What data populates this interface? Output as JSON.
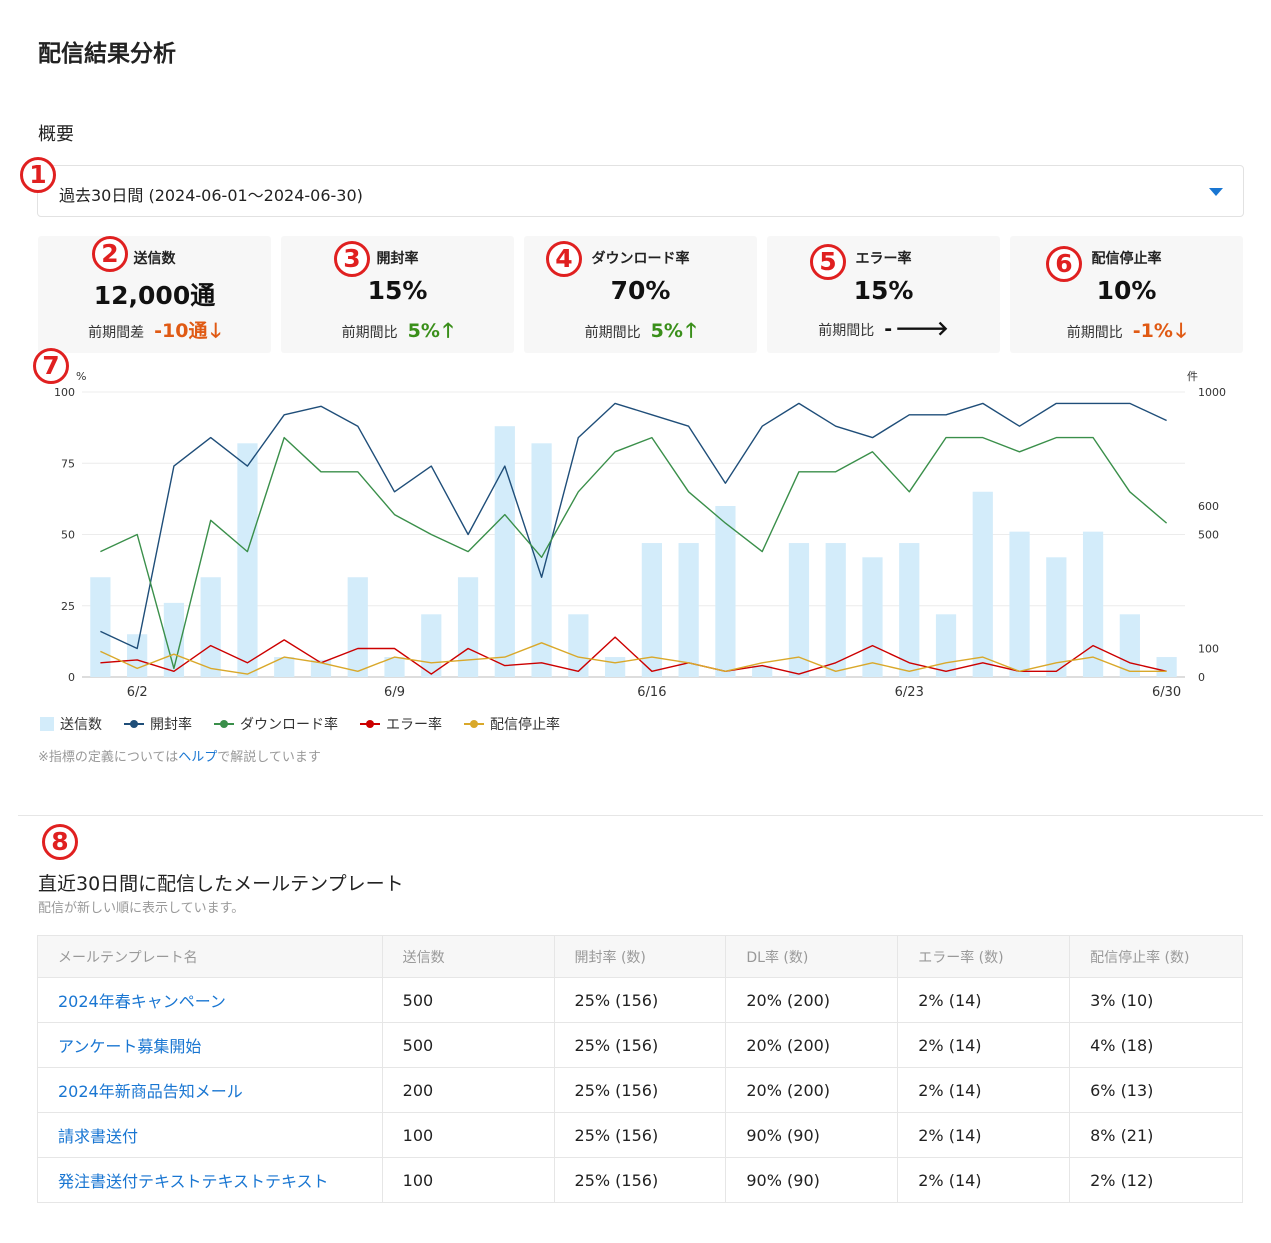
{
  "page": {
    "title": "配信結果分析",
    "section_label": "概要"
  },
  "markers": [
    "1",
    "2",
    "3",
    "4",
    "5",
    "6",
    "7",
    "8"
  ],
  "period_select": {
    "value": "過去30日間 (2024-06-01〜2024-06-30)"
  },
  "kpis": [
    {
      "title": "送信数",
      "value": "12,000通",
      "compare_label": "前期間差",
      "delta": "-10通",
      "trend": "down",
      "arrow": "🡓"
    },
    {
      "title": "開封率",
      "value": "15%",
      "compare_label": "前期間比",
      "delta": "5%",
      "trend": "up",
      "arrow": "🡑"
    },
    {
      "title": "ダウンロード率",
      "value": "70%",
      "compare_label": "前期間比",
      "delta": "5%",
      "trend": "up",
      "arrow": "🡑"
    },
    {
      "title": "エラー率",
      "value": "15%",
      "compare_label": "前期間比",
      "delta": "-",
      "trend": "flat",
      "arrow": "🡒"
    },
    {
      "title": "配信停止率",
      "value": "10%",
      "compare_label": "前期間比",
      "delta": "-1%",
      "trend": "down",
      "arrow": "🡓"
    }
  ],
  "colors": {
    "bar": "#d3ecfa",
    "open_rate": "#1f4e79",
    "download_rate": "#3a8f4a",
    "error_rate": "#cc0000",
    "unsubscribe_rate": "#d9a82a",
    "link": "#1976d2",
    "marker": "#e02020"
  },
  "chart_data": {
    "type": "bar+line",
    "left_axis_unit": "%",
    "right_axis_unit": "件",
    "ylim_left": [
      0,
      100
    ],
    "ylim_right": [
      0,
      1000
    ],
    "yticks_left": [
      0,
      25,
      50,
      75,
      100
    ],
    "yticks_right": [
      0,
      100,
      200,
      300,
      400,
      500,
      600,
      700,
      800,
      900,
      1000
    ],
    "yticks_right_labels": [
      0,
      100,
      500,
      600,
      1000
    ],
    "x": [
      1,
      2,
      3,
      4,
      5,
      6,
      7,
      8,
      9,
      10,
      11,
      12,
      13,
      14,
      15,
      16,
      17,
      18,
      19,
      20,
      21,
      22,
      23,
      24,
      25,
      26,
      27,
      28,
      29,
      30
    ],
    "xtick_labels": [
      {
        "day": 2,
        "label": "6/2"
      },
      {
        "day": 9,
        "label": "6/9"
      },
      {
        "day": 16,
        "label": "6/16"
      },
      {
        "day": 23,
        "label": "6/23"
      },
      {
        "day": 30,
        "label": "6/30"
      }
    ],
    "grid": true,
    "legend_position": "bottom-left",
    "series": [
      {
        "name": "送信数",
        "type": "bar",
        "axis": "right",
        "values": [
          350,
          150,
          260,
          350,
          820,
          70,
          60,
          350,
          70,
          220,
          350,
          880,
          820,
          220,
          70,
          470,
          470,
          600,
          40,
          470,
          470,
          420,
          470,
          220,
          650,
          510,
          420,
          510,
          220,
          70
        ]
      },
      {
        "name": "開封率",
        "type": "line",
        "axis": "left",
        "values": [
          16,
          10,
          74,
          84,
          74,
          92,
          95,
          88,
          65,
          74,
          50,
          74,
          35,
          84,
          96,
          92,
          88,
          68,
          88,
          96,
          88,
          84,
          92,
          92,
          96,
          88,
          96,
          96,
          96,
          90
        ]
      },
      {
        "name": "ダウンロード率",
        "type": "line",
        "axis": "left",
        "values": [
          44,
          50,
          3,
          55,
          44,
          84,
          72,
          72,
          57,
          50,
          44,
          57,
          42,
          65,
          79,
          84,
          65,
          54,
          44,
          72,
          72,
          79,
          65,
          84,
          84,
          79,
          84,
          84,
          65,
          54
        ]
      },
      {
        "name": "エラー率",
        "type": "line",
        "axis": "left",
        "values": [
          5,
          6,
          2,
          11,
          5,
          13,
          5,
          10,
          10,
          1,
          10,
          4,
          5,
          2,
          14,
          2,
          5,
          2,
          4,
          1,
          5,
          11,
          5,
          2,
          5,
          2,
          2,
          11,
          5,
          2
        ]
      },
      {
        "name": "配信停止率",
        "type": "line",
        "axis": "left",
        "values": [
          9,
          3,
          8,
          3,
          1,
          7,
          5,
          2,
          7,
          5,
          6,
          7,
          12,
          7,
          5,
          7,
          5,
          2,
          5,
          7,
          2,
          5,
          2,
          5,
          7,
          2,
          5,
          7,
          2,
          2
        ]
      }
    ]
  },
  "help_note": {
    "prefix": "※指標の定義については",
    "link": "ヘルプ",
    "suffix": "で解説しています"
  },
  "templates": {
    "title": "直近30日間に配信したメールテンプレート",
    "subtitle": "配信が新しい順に表示しています。",
    "columns": [
      "メールテンプレート名",
      "送信数",
      "開封率 (数)",
      "DL率 (数)",
      "エラー率 (数)",
      "配信停止率 (数)"
    ],
    "rows": [
      [
        "2024年春キャンペーン",
        "500",
        "25% (156)",
        "20% (200)",
        "2% (14)",
        "3% (10)"
      ],
      [
        "アンケート募集開始",
        "500",
        "25% (156)",
        "20% (200)",
        "2% (14)",
        "4% (18)"
      ],
      [
        "2024年新商品告知メール",
        "200",
        "25% (156)",
        "20% (200)",
        "2% (14)",
        "6% (13)"
      ],
      [
        "請求書送付",
        "100",
        "25% (156)",
        "90% (90)",
        "2% (14)",
        "8% (21)"
      ],
      [
        "発注書送付テキストテキストテキスト",
        "100",
        "25% (156)",
        "90% (90)",
        "2% (14)",
        "2% (12)"
      ]
    ]
  }
}
